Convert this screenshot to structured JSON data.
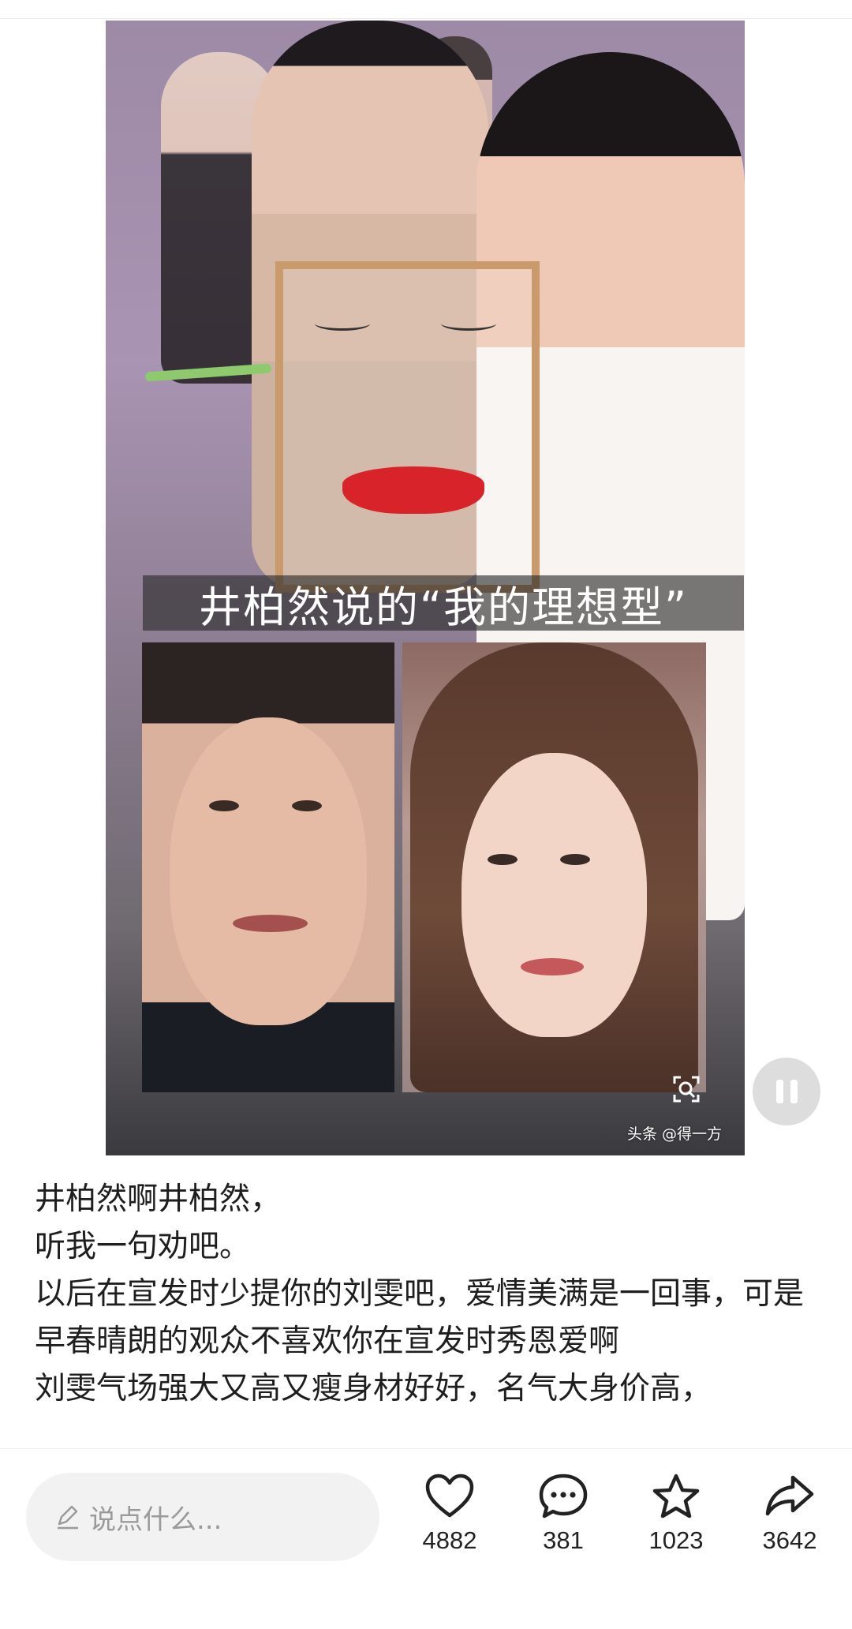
{
  "media": {
    "caption": "井柏然说的“我的理想型”",
    "watermark": "头条 @得一方"
  },
  "article": {
    "lines": [
      "井柏然啊井柏然，",
      "听我一句劝吧。",
      "以后在宣发时少提你的刘雯吧，爱情美满是一回事，可是早春晴朗的观众不喜欢你在宣发时秀恩爱啊",
      "刘雯气场强大又高又瘦身材好好，名气大身价高，"
    ]
  },
  "bottom_bar": {
    "comment_placeholder": "说点什么...",
    "like_count": "4882",
    "comment_count": "381",
    "favorite_count": "1023",
    "share_count": "3642"
  }
}
